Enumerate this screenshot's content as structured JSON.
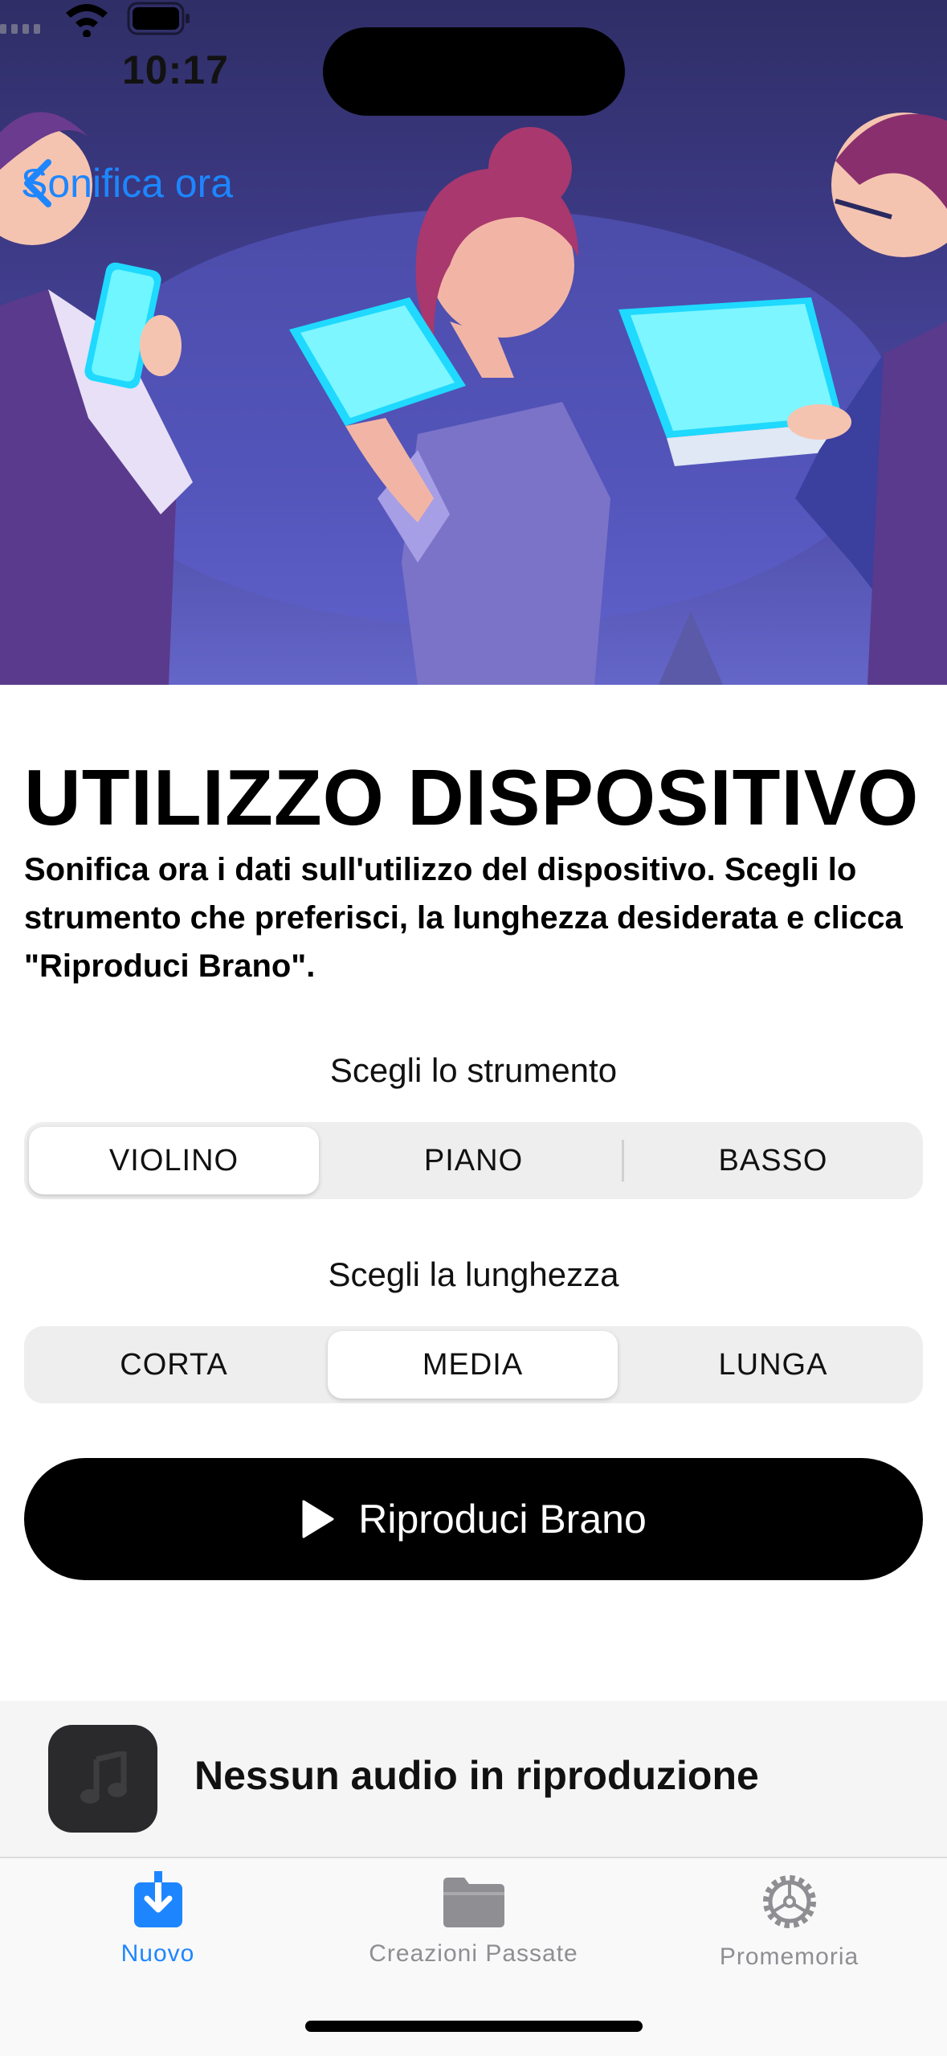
{
  "status": {
    "time": "10:17"
  },
  "nav": {
    "back_label": "Sonifica ora"
  },
  "main": {
    "title": "UTILIZZO DISPOSITIVO",
    "description": "Sonifica ora i dati sull'utilizzo del dispositivo. Scegli lo strumento che preferisci, la lunghezza desiderata e clicca \"Riproduci Brano\"."
  },
  "instrument": {
    "label": "Scegli lo strumento",
    "options": [
      "VIOLINO",
      "PIANO",
      "BASSO"
    ],
    "selected": "VIOLINO"
  },
  "length": {
    "label": "Scegli la lunghezza",
    "options": [
      "CORTA",
      "MEDIA",
      "LUNGA"
    ],
    "selected": "MEDIA"
  },
  "play_button": {
    "label": "Riproduci Brano",
    "icon": "play-icon"
  },
  "now_playing": {
    "text": "Nessun audio in riproduzione",
    "icon": "music-note-icon"
  },
  "tabs": [
    {
      "label": "Nuovo",
      "icon": "download-icon",
      "active": true
    },
    {
      "label": "Creazioni Passate",
      "icon": "folder-icon",
      "active": false
    },
    {
      "label": "Promemoria",
      "icon": "gear-icon",
      "active": false
    }
  ],
  "colors": {
    "accent": "#1d86ff",
    "inactive_tab": "#8e8e93",
    "segment_bg": "#eeeeef"
  }
}
